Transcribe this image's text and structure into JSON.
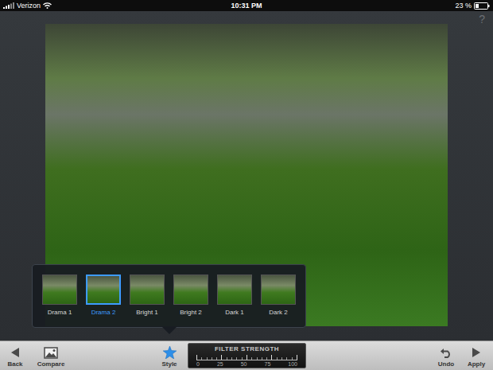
{
  "status_bar": {
    "carrier": "Verizon",
    "time": "10:31 PM",
    "battery": "23 %"
  },
  "help": "?",
  "styles": [
    {
      "label": "Drama 1",
      "selected": false
    },
    {
      "label": "Drama 2",
      "selected": true
    },
    {
      "label": "Bright 1",
      "selected": false
    },
    {
      "label": "Bright 2",
      "selected": false
    },
    {
      "label": "Dark 1",
      "selected": false
    },
    {
      "label": "Dark 2",
      "selected": false
    }
  ],
  "toolbar": {
    "back": "Back",
    "compare": "Compare",
    "style": "Style",
    "undo": "Undo",
    "apply": "Apply"
  },
  "filter_strength": {
    "title": "FILTER STRENGTH",
    "ticks": [
      "0",
      "25",
      "50",
      "75",
      "100"
    ]
  }
}
